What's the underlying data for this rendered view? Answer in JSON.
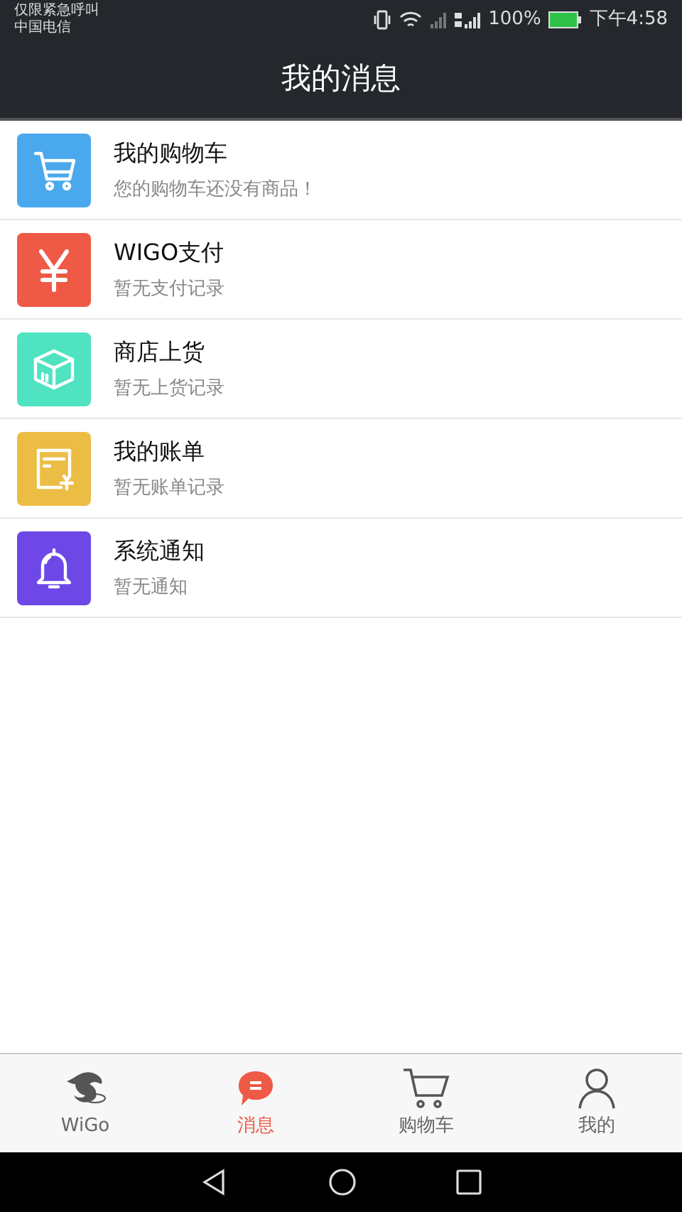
{
  "status_bar": {
    "carrier_notice": "仅限紧急呼叫",
    "carrier": "中国电信",
    "battery": "100%",
    "time": "下午4:58"
  },
  "header": {
    "title": "我的消息"
  },
  "messages": [
    {
      "title": "我的购物车",
      "subtitle": "您的购物车还没有商品！",
      "color": "#4aa8ec"
    },
    {
      "title": "WIGO支付",
      "subtitle": "暂无支付记录",
      "color": "#ee5a45"
    },
    {
      "title": "商店上货",
      "subtitle": "暂无上货记录",
      "color": "#4fe3c1"
    },
    {
      "title": "我的账单",
      "subtitle": "暂无账单记录",
      "color": "#ecbd45"
    },
    {
      "title": "系统通知",
      "subtitle": "暂无通知",
      "color": "#6d48e6"
    }
  ],
  "tabs": [
    {
      "label": "WiGo",
      "selected": false
    },
    {
      "label": "消息",
      "selected": true
    },
    {
      "label": "购物车",
      "selected": false
    },
    {
      "label": "我的",
      "selected": false
    }
  ]
}
